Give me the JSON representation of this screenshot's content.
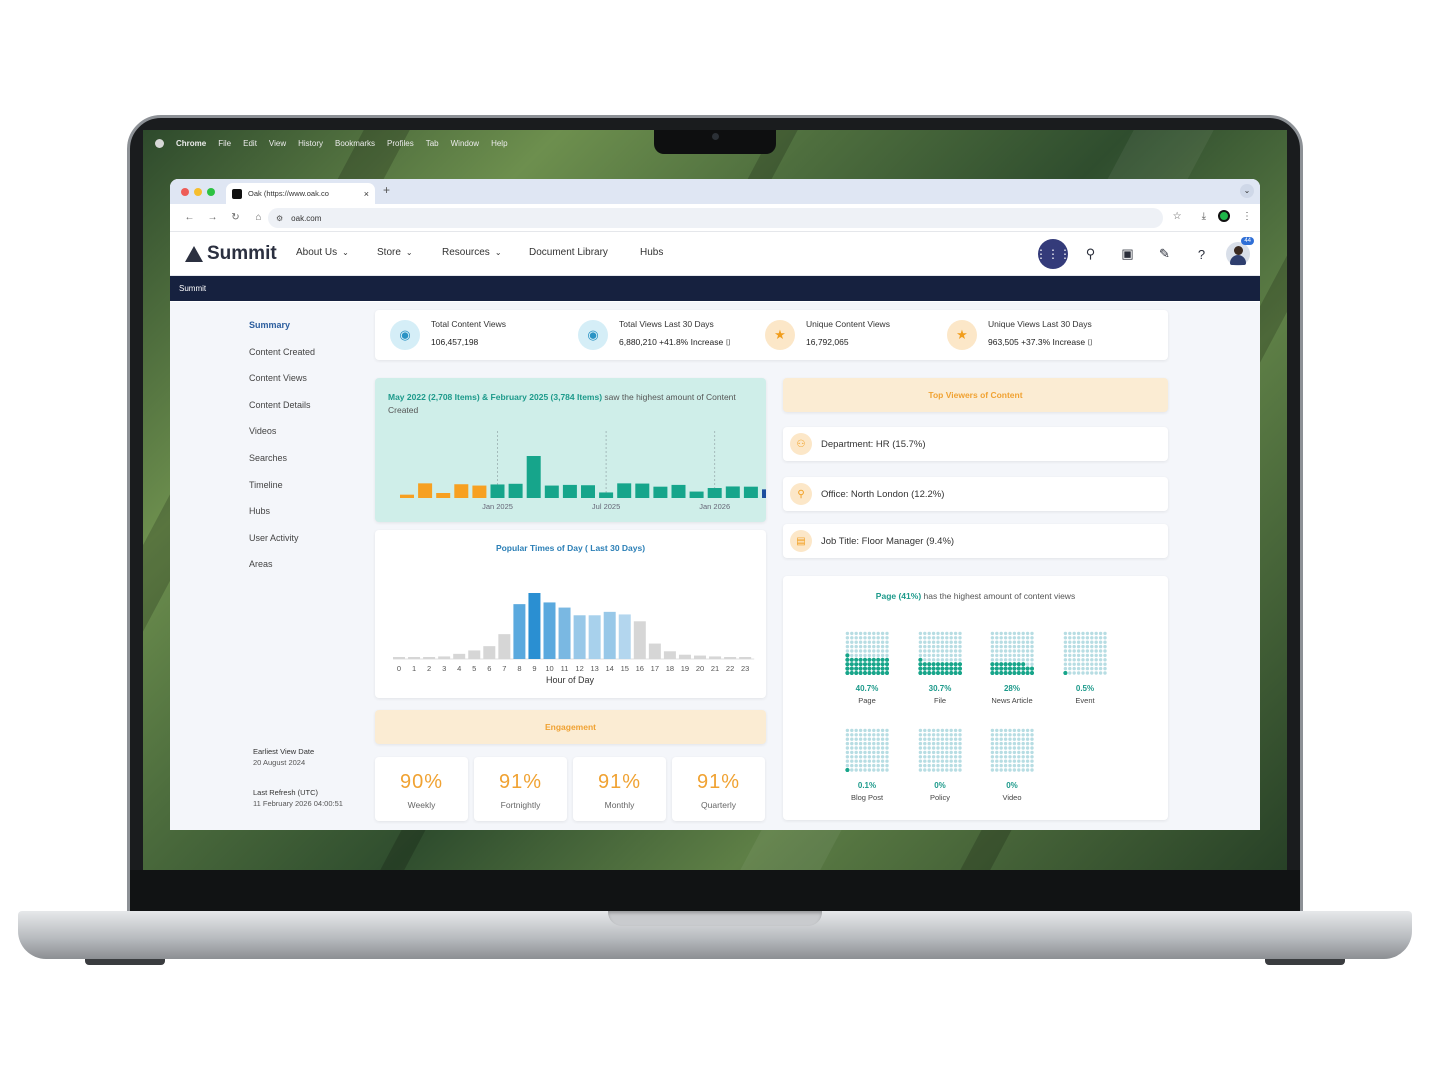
{
  "mac_menu": [
    "Chrome",
    "File",
    "Edit",
    "View",
    "History",
    "Bookmarks",
    "Profiles",
    "Tab",
    "Window",
    "Help"
  ],
  "browser": {
    "tab_title": "Oak (https://www.oak.co",
    "tab_close": "×",
    "new_tab": "+",
    "url": "oak.com"
  },
  "app": {
    "logo": "Summit",
    "nav": {
      "about": "About Us",
      "store": "Store",
      "resources": "Resources",
      "library": "Document Library",
      "hubs": "Hubs"
    },
    "notification_count": "44",
    "breadcrumb": "Summit"
  },
  "sidebar": {
    "items": [
      "Summary",
      "Content Created",
      "Content Views",
      "Content Details",
      "Videos",
      "Searches",
      "Timeline",
      "Hubs",
      "User Activity",
      "Areas"
    ],
    "earliest_label": "Earliest View Date",
    "earliest_value": "20 August 2024",
    "refresh_label": "Last Refresh (UTC)",
    "refresh_value": "11 February 2026 04:00:51"
  },
  "kpis": [
    {
      "label": "Total Content Views",
      "value": "106,457,198"
    },
    {
      "label": "Total Views Last 30 Days",
      "value": "6,880,210 +41.8% Increase ⌷"
    },
    {
      "label": "Unique Content Views",
      "value": "16,792,065"
    },
    {
      "label": "Unique Views Last 30 Days",
      "value": "963,505 +37.3% Increase ⌷"
    }
  ],
  "created": {
    "highlight": "May 2022 (2,708 Items) & February 2025 (3,784 Items)",
    "text": " saw the highest amount of Content Created"
  },
  "hours": {
    "title": "Popular Times of Day ( Last 30 Days)"
  },
  "engagement": {
    "title": "Engagement",
    "items": [
      {
        "value": "90%",
        "label": "Weekly"
      },
      {
        "value": "91%",
        "label": "Fortnightly"
      },
      {
        "value": "91%",
        "label": "Monthly"
      },
      {
        "value": "91%",
        "label": "Quarterly"
      }
    ]
  },
  "viewers": {
    "title": "Top Viewers of Content",
    "rows": [
      "Department: HR (15.7%)",
      "Office: North London (12.2%)",
      "Job Title: Floor Manager (9.4%)"
    ]
  },
  "content_types": {
    "highlight": "Page (41%)",
    "text": " has the highest amount of content views",
    "items": [
      {
        "pct": "40.7%",
        "label": "Page",
        "fraction": 0.407
      },
      {
        "pct": "30.7%",
        "label": "File",
        "fraction": 0.307
      },
      {
        "pct": "28%",
        "label": "News Article",
        "fraction": 0.28
      },
      {
        "pct": "0.5%",
        "label": "Event",
        "fraction": 0.005
      },
      {
        "pct": "0.1%",
        "label": "Blog Post",
        "fraction": 0.001
      },
      {
        "pct": "0%",
        "label": "Policy",
        "fraction": 0
      },
      {
        "pct": "0%",
        "label": "Video",
        "fraction": 0
      }
    ]
  },
  "chart_data": [
    {
      "type": "bar",
      "title": "",
      "x_tick_labels": [
        "Jan 2025",
        "Jul 2025",
        "Jan 2026"
      ],
      "ylim": [
        0,
        3784
      ],
      "values": [
        300,
        1320,
        450,
        1240,
        1120,
        1220,
        1280,
        3784,
        1120,
        1180,
        1150,
        500,
        1320,
        1300,
        1020,
        1180,
        580,
        900,
        1040,
        1020,
        780,
        500
      ],
      "colors": [
        "#f7a021",
        "#f7a021",
        "#f7a021",
        "#f7a021",
        "#f7a021",
        "#16a58b",
        "#16a58b",
        "#16a58b",
        "#16a58b",
        "#16a58b",
        "#16a58b",
        "#16a58b",
        "#16a58b",
        "#16a58b",
        "#16a58b",
        "#16a58b",
        "#16a58b",
        "#16a58b",
        "#16a58b",
        "#16a58b",
        "#1d4f9e",
        "#1d4f9e"
      ],
      "grid": false,
      "legend": "none"
    },
    {
      "type": "bar",
      "title": "Popular Times of Day ( Last 30 Days)",
      "xlabel": "Hour of Day",
      "categories": [
        "0",
        "1",
        "2",
        "3",
        "4",
        "5",
        "6",
        "7",
        "8",
        "9",
        "10",
        "11",
        "12",
        "13",
        "14",
        "15",
        "16",
        "17",
        "18",
        "19",
        "20",
        "21",
        "22",
        "23"
      ],
      "values": [
        1,
        1,
        1,
        3,
        6,
        10,
        15,
        29,
        64,
        77,
        66,
        60,
        51,
        51,
        55,
        52,
        44,
        18,
        9,
        5,
        4,
        3,
        2,
        1
      ],
      "colors": [
        "#d6d6d6",
        "#d6d6d6",
        "#d6d6d6",
        "#d6d6d6",
        "#d6d6d6",
        "#d6d6d6",
        "#d6d6d6",
        "#d6d6d6",
        "#5aa9de",
        "#2a8fd2",
        "#5aa9de",
        "#7ab8e2",
        "#98c8e8",
        "#a8d1ec",
        "#98c8e8",
        "#b3d6ee",
        "#d6d6d6",
        "#d6d6d6",
        "#d6d6d6",
        "#d6d6d6",
        "#d6d6d6",
        "#d6d6d6",
        "#d6d6d6",
        "#d6d6d6"
      ],
      "grid": false,
      "legend": "none"
    }
  ],
  "colors": {
    "accent_teal": "#1d9a8b",
    "accent_orange": "#f0a232",
    "header_navy": "#16213f",
    "apps_button": "#343b7a"
  }
}
